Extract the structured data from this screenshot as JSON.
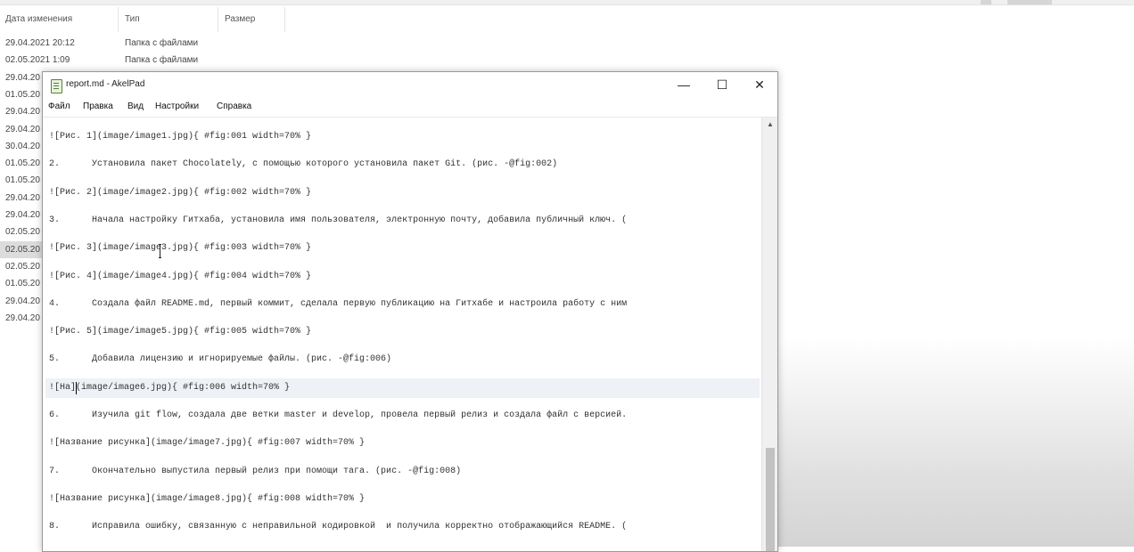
{
  "explorer": {
    "columns": [
      "Дата изменения",
      "Тип",
      "Размер"
    ],
    "rows": [
      {
        "date": "29.04.2021 20:12",
        "type": "Папка с файлами"
      },
      {
        "date": "02.05.2021 1:09",
        "type": "Папка с файлами"
      },
      {
        "date": "29.04.20",
        "type": ""
      },
      {
        "date": "01.05.20",
        "type": ""
      },
      {
        "date": "29.04.20",
        "type": ""
      },
      {
        "date": "29.04.20",
        "type": ""
      },
      {
        "date": "30.04.20",
        "type": ""
      },
      {
        "date": "01.05.20",
        "type": ""
      },
      {
        "date": "01.05.20",
        "type": ""
      },
      {
        "date": "29.04.20",
        "type": ""
      },
      {
        "date": "29.04.20",
        "type": ""
      },
      {
        "date": "02.05.20",
        "type": ""
      },
      {
        "date": "02.05.20",
        "type": ""
      },
      {
        "date": "02.05.20",
        "type": ""
      },
      {
        "date": "01.05.20",
        "type": ""
      },
      {
        "date": "29.04.20",
        "type": ""
      },
      {
        "date": "29.04.20",
        "type": ""
      }
    ]
  },
  "window": {
    "title": "report.md - AkelPad",
    "minimize_glyph": "—",
    "maximize_glyph": "☐",
    "close_glyph": "✕",
    "menu": [
      "Файл",
      "Правка",
      "Вид",
      "Настройки",
      "Справка"
    ]
  },
  "editor": {
    "lines": [
      "![Рис. 1](image/image1.jpg){ #fig:001 width=70% }",
      "2.      Установила пакет Chocolately, с помощью которого установила пакет Git. (рис. -@fig:002)",
      "![Рис. 2](image/image2.jpg){ #fig:002 width=70% }",
      "3.      Начала настройку Гитхаба, установила имя пользователя, электронную почту, добавила публичный ключ. (",
      "![Рис. 3](image/image3.jpg){ #fig:003 width=70% }",
      "![Рис. 4](image/image4.jpg){ #fig:004 width=70% }",
      "4.      Создала файл README.md, первый коммит, сделала первую публикацию на Гитхабе и настроила работу с ним",
      "![Рис. 5](image/image5.jpg){ #fig:005 width=70% }",
      "5.      Добавила лицензию и игнорируемые файлы. (рис. -@fig:006)",
      "![На](image/image6.jpg){ #fig:006 width=70% }",
      "6.      Изучила git flow, создала две ветки master и develop, провела первый релиз и создала файл с версией.",
      "![Название рисунка](image/image7.jpg){ #fig:007 width=70% }",
      "7.      Окончательно выпустила первый релиз при помощи тага. (рис. -@fig:008)",
      "![Название рисунка](image/image8.jpg){ #fig:008 width=70% }",
      "8.      Исправила ошибку, связанную с неправильной кодировкой  и получила корректно отображающийся README. ("
    ],
    "current_line": 9
  }
}
